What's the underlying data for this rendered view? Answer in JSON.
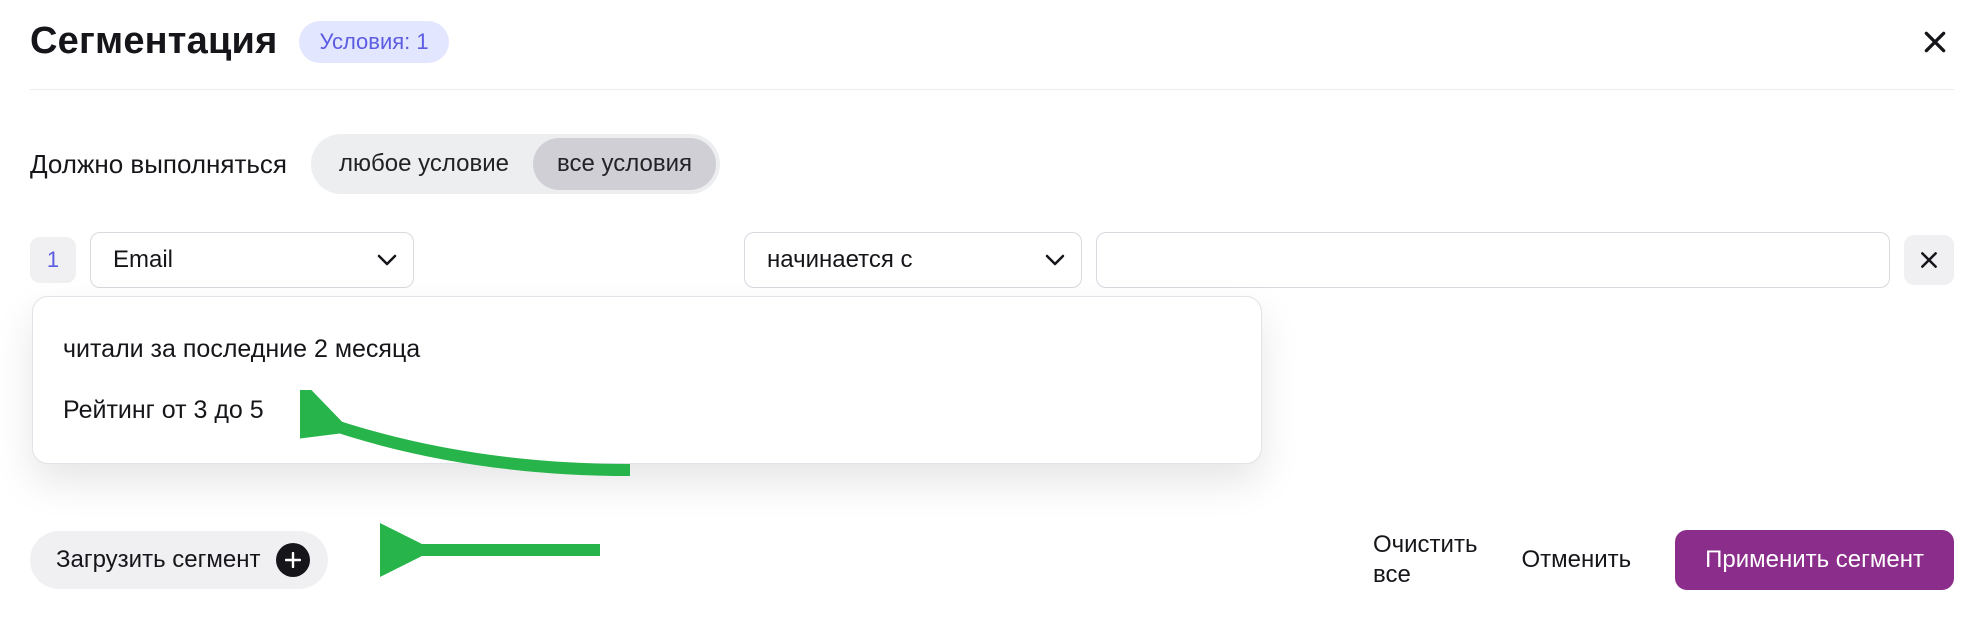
{
  "header": {
    "title": "Сегментация",
    "badge": "Условия: 1"
  },
  "match": {
    "label": "Должно выполняться",
    "options": {
      "any": "любое условие",
      "all": "все условия"
    },
    "selected": "all"
  },
  "condition": {
    "index": "1",
    "field": "Email",
    "operator": "начинается с",
    "value": ""
  },
  "dropdown": {
    "items": [
      "читали за последние 2 месяца",
      "Рейтинг от 3 до 5"
    ]
  },
  "footer": {
    "load": "Загрузить сегмент",
    "clear_l1": "Очистить",
    "clear_l2": "все",
    "cancel": "Отменить",
    "apply": "Применить сегмент"
  }
}
